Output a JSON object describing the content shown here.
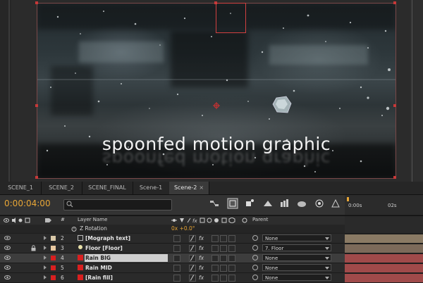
{
  "composition": {
    "title_text": "spoonfed motion graphic"
  },
  "timeline": {
    "tabs": [
      {
        "label": "SCENE_1",
        "active": false
      },
      {
        "label": "SCENE_2",
        "active": false
      },
      {
        "label": "SCENE_FINAL",
        "active": false
      },
      {
        "label": "Scene-1",
        "active": false
      },
      {
        "label": "Scene-2",
        "active": true,
        "close": "×"
      }
    ],
    "timecode": "0:00:04:00",
    "search": {
      "placeholder": ""
    },
    "ruler": {
      "label_start": "0:00s",
      "label_2s": "02s"
    },
    "columns": {
      "hash": "#",
      "layer_name": "Layer Name",
      "parent": "Parent"
    },
    "property_row": {
      "name": "Z Rotation",
      "value": "0x +0.0°"
    },
    "layers": [
      {
        "index": "2",
        "name": "[Mograph text]",
        "label_color": "#d8c8a8",
        "parent": "None",
        "bar_color": "#8a7a64"
      },
      {
        "index": "3",
        "name": "Floor [Floor]",
        "label_color": "#e8c8a0",
        "parent": "7. Floor",
        "bar_color": "#7c6a5a",
        "locked": true
      },
      {
        "index": "4",
        "name": "Rain BIG",
        "label_color": "#d82020",
        "parent": "None",
        "bar_color": "#a04a4a",
        "selected": true
      },
      {
        "index": "5",
        "name": "Rain MID",
        "label_color": "#d82020",
        "parent": "None",
        "bar_color": "#a04a4a"
      },
      {
        "index": "6",
        "name": "[Rain fill]",
        "label_color": "#d82020",
        "parent": "None",
        "bar_color": "#a04a4a"
      }
    ]
  },
  "colors": {
    "accent_timecode": "#e8a636",
    "selection_handles": "#c83838",
    "panel_bg": "#2a2a2a"
  }
}
